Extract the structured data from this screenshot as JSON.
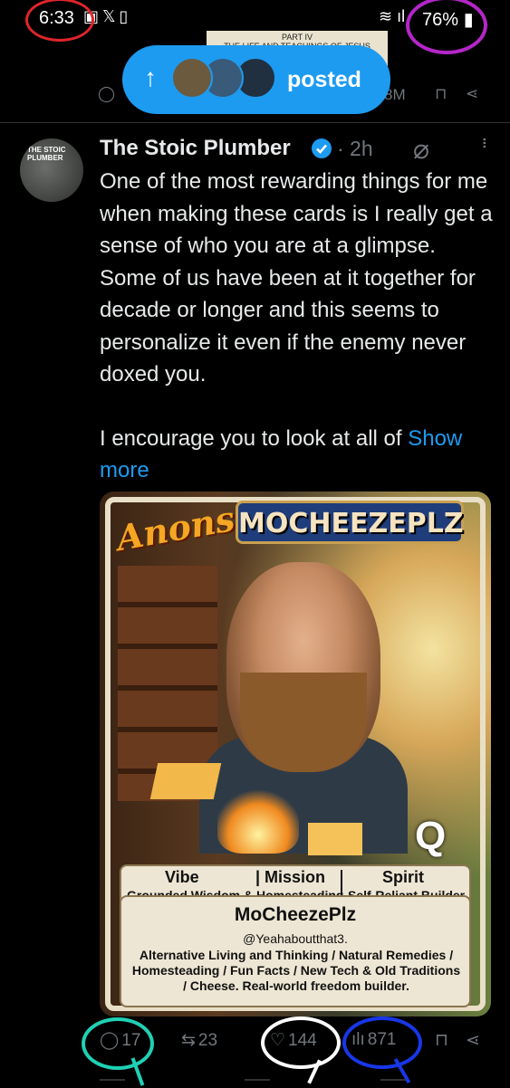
{
  "status_bar": {
    "time": "6:33",
    "battery": "76%",
    "icons": [
      "photo-icon",
      "x-icon",
      "clipboard-icon",
      "wifi-icon",
      "signal-icon",
      "battery-icon"
    ]
  },
  "previous_post": {
    "image_text": "PART IV\nTHE LIFE AND TEACHINGS OF JESUS",
    "views": "8M"
  },
  "posted_pill": {
    "label": "posted",
    "avatars": [
      "STRAIGHT OUTTA PHOTOSHOP",
      "avatar-2",
      "avatar-3"
    ]
  },
  "post": {
    "author": "The Stoic Plumber",
    "avatar_text": "THE STOIC PLUMBER",
    "verified": true,
    "time": "· 2h",
    "paragraph_1": "One of the most rewarding things for me when making these cards is I really get a sense of who you are at a glimpse. Some of us have been at it together for decade or longer and this seems to personalize it even if the enemy never doxed you.",
    "paragraph_2": "I encourage you to look at all of ",
    "show_more": "Show more"
  },
  "card": {
    "brand": "Anons",
    "title": "MOCHEEZEPLZ",
    "badge": "Q",
    "vibe_label": "Vibe",
    "vibe_value": "Grounded Wisdom & Homesteading",
    "mission_label": "| Mission",
    "spirit_label": "Spirit",
    "spirit_value": "Self-Reliant Builder",
    "name": "MoCheezePlz",
    "handle": "@Yeahaboutthat3.",
    "description": "Alternative Living and Thinking / Natural Remedies / Homesteading / Fun Facts / New Tech & Old Traditions / Cheese. Real-world freedom builder."
  },
  "actions": {
    "replies": "17",
    "reposts": "23",
    "likes": "144",
    "views": "871"
  },
  "annotation_colors": {
    "red": "#e0242b",
    "purple": "#b526c9",
    "teal": "#1fd1b5",
    "white": "#ffffff",
    "blue": "#1737e8",
    "accent": "#1d9bf0"
  }
}
